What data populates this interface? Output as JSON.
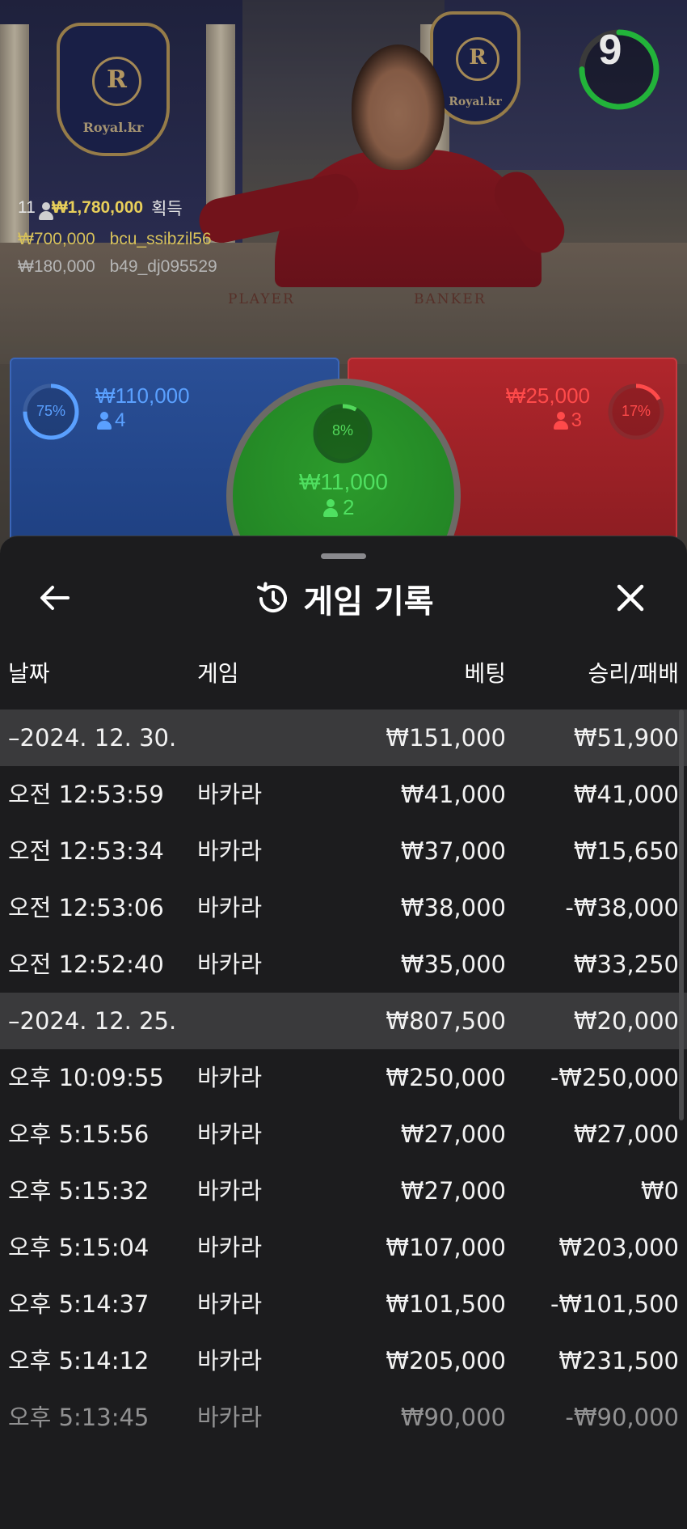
{
  "video": {
    "timer": "9",
    "timer_progress": 0.75,
    "crest_left": {
      "letter": "R",
      "label": "Royal.kr"
    },
    "crest_right": {
      "letter": "R",
      "label": "Royal.kr"
    },
    "felt": {
      "player": "PLAYER",
      "banker": "BANKER"
    },
    "win_feed": {
      "count": "11",
      "amount": "₩1,780,000",
      "suffix": "획득",
      "entries": [
        {
          "amount": "₩700,000",
          "user": "bcu_ssibzil56"
        },
        {
          "amount": "₩180,000",
          "user": "b49_dj095529"
        }
      ]
    }
  },
  "bets": {
    "player": {
      "percent": "75%",
      "percent_value": 0.75,
      "amount": "₩110,000",
      "people": "4",
      "color": "#5aa0ff"
    },
    "tie": {
      "percent": "8%",
      "percent_value": 0.08,
      "amount": "₩11,000",
      "people": "2",
      "color": "#4fe060"
    },
    "banker": {
      "percent": "17%",
      "percent_value": 0.17,
      "amount": "₩25,000",
      "people": "3",
      "color": "#ff4a4a"
    }
  },
  "history": {
    "title": "게임 기록",
    "columns": {
      "date": "날짜",
      "game": "게임",
      "bet": "베팅",
      "win": "승리/패배"
    },
    "rows": [
      {
        "type": "group",
        "date": "–2024. 12. 30.",
        "game": "",
        "bet": "₩151,000",
        "win": "₩51,900"
      },
      {
        "type": "item",
        "date": "오전 12:53:59",
        "game": "바카라",
        "bet": "₩41,000",
        "win": "₩41,000"
      },
      {
        "type": "item",
        "date": "오전 12:53:34",
        "game": "바카라",
        "bet": "₩37,000",
        "win": "₩15,650"
      },
      {
        "type": "item",
        "date": "오전 12:53:06",
        "game": "바카라",
        "bet": "₩38,000",
        "win": "-₩38,000"
      },
      {
        "type": "item",
        "date": "오전 12:52:40",
        "game": "바카라",
        "bet": "₩35,000",
        "win": "₩33,250"
      },
      {
        "type": "group",
        "date": "–2024. 12. 25.",
        "game": "",
        "bet": "₩807,500",
        "win": "₩20,000"
      },
      {
        "type": "item",
        "date": "오후 10:09:55",
        "game": "바카라",
        "bet": "₩250,000",
        "win": "-₩250,000"
      },
      {
        "type": "item",
        "date": "오후 5:15:56",
        "game": "바카라",
        "bet": "₩27,000",
        "win": "₩27,000"
      },
      {
        "type": "item",
        "date": "오후 5:15:32",
        "game": "바카라",
        "bet": "₩27,000",
        "win": "₩0"
      },
      {
        "type": "item",
        "date": "오후 5:15:04",
        "game": "바카라",
        "bet": "₩107,000",
        "win": "₩203,000"
      },
      {
        "type": "item",
        "date": "오후 5:14:37",
        "game": "바카라",
        "bet": "₩101,500",
        "win": "-₩101,500"
      },
      {
        "type": "item",
        "date": "오후 5:14:12",
        "game": "바카라",
        "bet": "₩205,000",
        "win": "₩231,500"
      },
      {
        "type": "item",
        "date": "오후 5:13:45",
        "game": "바카라",
        "bet": "₩90,000",
        "win": "-₩90,000"
      }
    ]
  },
  "icons": {
    "back": "arrow-left-icon",
    "history": "history-icon",
    "close": "close-icon",
    "person": "person-icon"
  }
}
